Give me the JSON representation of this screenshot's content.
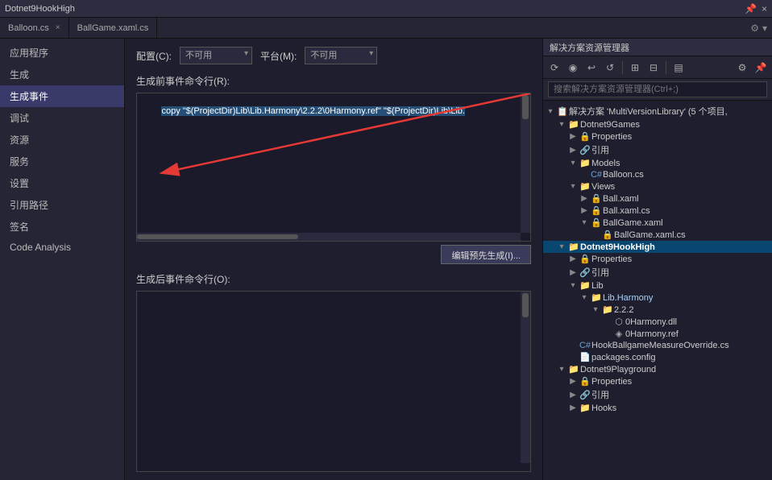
{
  "titleBar": {
    "title": "Dotnet9HookHigh",
    "closeBtn": "×",
    "pinBtn": "📌"
  },
  "tabs": [
    {
      "label": "Balloon.cs",
      "closable": true,
      "active": false
    },
    {
      "label": "BallGame.xaml.cs",
      "closable": false,
      "active": false
    }
  ],
  "sidebar": {
    "items": [
      {
        "label": "应用程序",
        "id": "app"
      },
      {
        "label": "生成",
        "id": "build"
      },
      {
        "label": "生成事件",
        "id": "build-events",
        "active": true
      },
      {
        "label": "调试",
        "id": "debug"
      },
      {
        "label": "资源",
        "id": "resources"
      },
      {
        "label": "服务",
        "id": "services"
      },
      {
        "label": "设置",
        "id": "settings"
      },
      {
        "label": "引用路径",
        "id": "ref-path"
      },
      {
        "label": "签名",
        "id": "sign"
      },
      {
        "label": "Code Analysis",
        "id": "code-analysis"
      }
    ]
  },
  "mainPanel": {
    "configLabel": "配置(C):",
    "configValue": "不可用",
    "platformLabel": "平台(M):",
    "platformValue": "不可用",
    "preBuildLabel": "生成前事件命令行(R):",
    "preBuildCommand": "copy \"$(ProjectDir)Lib\\Lib.Harmony\\2.2.2\\0Harmony.ref\" \"$(ProjectDir)Lib\\Lib.",
    "editPreBuildBtn": "编辑预先生成(I)...",
    "postBuildLabel": "生成后事件命令行(O):"
  },
  "rightPanel": {
    "title": "解决方案资源管理器",
    "searchPlaceholder": "搜索解决方案资源管理器(Ctrl+;)",
    "solutionLabel": "解决方案 'MultiVersionLibrary' (5 个项目,",
    "tree": [
      {
        "indent": 0,
        "arrow": "▾",
        "icon": "🗂",
        "label": "解决方案 'MultiVersionLibrary' (5 个项目,",
        "type": "solution"
      },
      {
        "indent": 1,
        "arrow": "▾",
        "icon": "📁",
        "label": "Dotnet9Games",
        "type": "project"
      },
      {
        "indent": 2,
        "arrow": "▶",
        "icon": "🔒",
        "label": "Properties",
        "type": "folder"
      },
      {
        "indent": 2,
        "arrow": "▶",
        "icon": "🔗",
        "label": "引用",
        "type": "folder"
      },
      {
        "indent": 2,
        "arrow": "▾",
        "icon": "📁",
        "label": "Models",
        "type": "folder"
      },
      {
        "indent": 3,
        "arrow": "",
        "icon": "C#",
        "label": "Balloon.cs",
        "type": "cs"
      },
      {
        "indent": 2,
        "arrow": "▾",
        "icon": "📁",
        "label": "Views",
        "type": "folder"
      },
      {
        "indent": 3,
        "arrow": "▶",
        "icon": "🔒",
        "label": "Ball.xaml",
        "type": "xaml"
      },
      {
        "indent": 3,
        "arrow": "▶",
        "icon": "🔒",
        "label": "Ball.xaml.cs",
        "type": "cs"
      },
      {
        "indent": 3,
        "arrow": "▾",
        "icon": "🔒",
        "label": "BallGame.xaml",
        "type": "xaml"
      },
      {
        "indent": 4,
        "arrow": "",
        "icon": "C#",
        "label": "BallGame.xaml.cs",
        "type": "cs"
      },
      {
        "indent": 1,
        "arrow": "▾",
        "icon": "📁",
        "label": "Dotnet9HookHigh",
        "type": "project",
        "selected": true
      },
      {
        "indent": 2,
        "arrow": "▶",
        "icon": "🔒",
        "label": "Properties",
        "type": "folder"
      },
      {
        "indent": 2,
        "arrow": "▶",
        "icon": "🔗",
        "label": "引用",
        "type": "folder"
      },
      {
        "indent": 2,
        "arrow": "▾",
        "icon": "📁",
        "label": "Lib",
        "type": "folder"
      },
      {
        "indent": 3,
        "arrow": "▾",
        "icon": "📁",
        "label": "Lib.Harmony",
        "type": "folder"
      },
      {
        "indent": 4,
        "arrow": "▾",
        "icon": "📁",
        "label": "2.2.2",
        "type": "folder"
      },
      {
        "indent": 5,
        "arrow": "",
        "icon": "DLL",
        "label": "0Harmony.dll",
        "type": "dll"
      },
      {
        "indent": 5,
        "arrow": "",
        "icon": "REF",
        "label": "0Harmony.ref",
        "type": "ref"
      },
      {
        "indent": 2,
        "arrow": "",
        "icon": "C#",
        "label": "HookBallgameMeasureOverride.cs",
        "type": "cs"
      },
      {
        "indent": 2,
        "arrow": "",
        "icon": "📄",
        "label": "packages.config",
        "type": "file"
      },
      {
        "indent": 1,
        "arrow": "▾",
        "icon": "📁",
        "label": "Dotnet9Playground",
        "type": "project"
      },
      {
        "indent": 2,
        "arrow": "▶",
        "icon": "🔒",
        "label": "Properties",
        "type": "folder"
      },
      {
        "indent": 2,
        "arrow": "▶",
        "icon": "🔗",
        "label": "引用",
        "type": "folder"
      },
      {
        "indent": 2,
        "arrow": "▶",
        "icon": "📁",
        "label": "Hooks",
        "type": "folder"
      }
    ]
  }
}
